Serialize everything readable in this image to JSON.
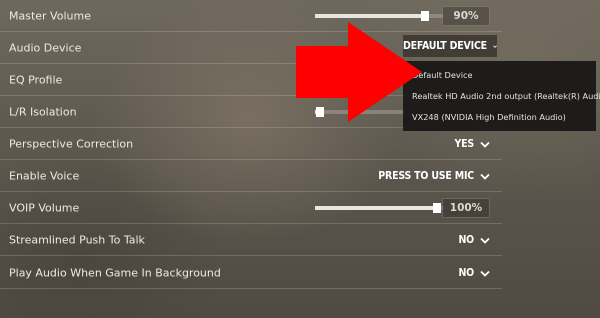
{
  "settings": [
    {
      "label": "Master Volume",
      "control": "slider",
      "value_text": "90%",
      "level": 0.9
    },
    {
      "label": "Audio Device",
      "control": "dropdown",
      "value_text": "DEFAULT DEVICE"
    },
    {
      "label": "EQ Profile",
      "control": "hidden"
    },
    {
      "label": "L/R Isolation",
      "control": "slider-partial",
      "level": 0.05
    },
    {
      "label": "Perspective Correction",
      "control": "toggle",
      "value_text": "YES"
    },
    {
      "label": "Enable Voice",
      "control": "toggle",
      "value_text": "PRESS TO USE MIC"
    },
    {
      "label": "VOIP Volume",
      "control": "slider",
      "value_text": "100%",
      "level": 1.0
    },
    {
      "label": "Streamlined Push To Talk",
      "control": "toggle",
      "value_text": "NO"
    },
    {
      "label": "Play Audio When Game In Background",
      "control": "toggle",
      "value_text": "NO"
    }
  ],
  "audio_device_dropdown": {
    "selected": "DEFAULT DEVICE",
    "options": [
      "Default Device",
      "Realtek HD Audio 2nd output (Realtek(R) Audio)",
      "VX248 (NVIDIA High Definition Audio)"
    ]
  },
  "icons": {
    "chevron": "chevron-down-icon",
    "annotation": "red-arrow-annotation"
  },
  "colors": {
    "arrow": "#ff0000",
    "text": "#eeeae3",
    "dropdown_bg": "#181715"
  }
}
